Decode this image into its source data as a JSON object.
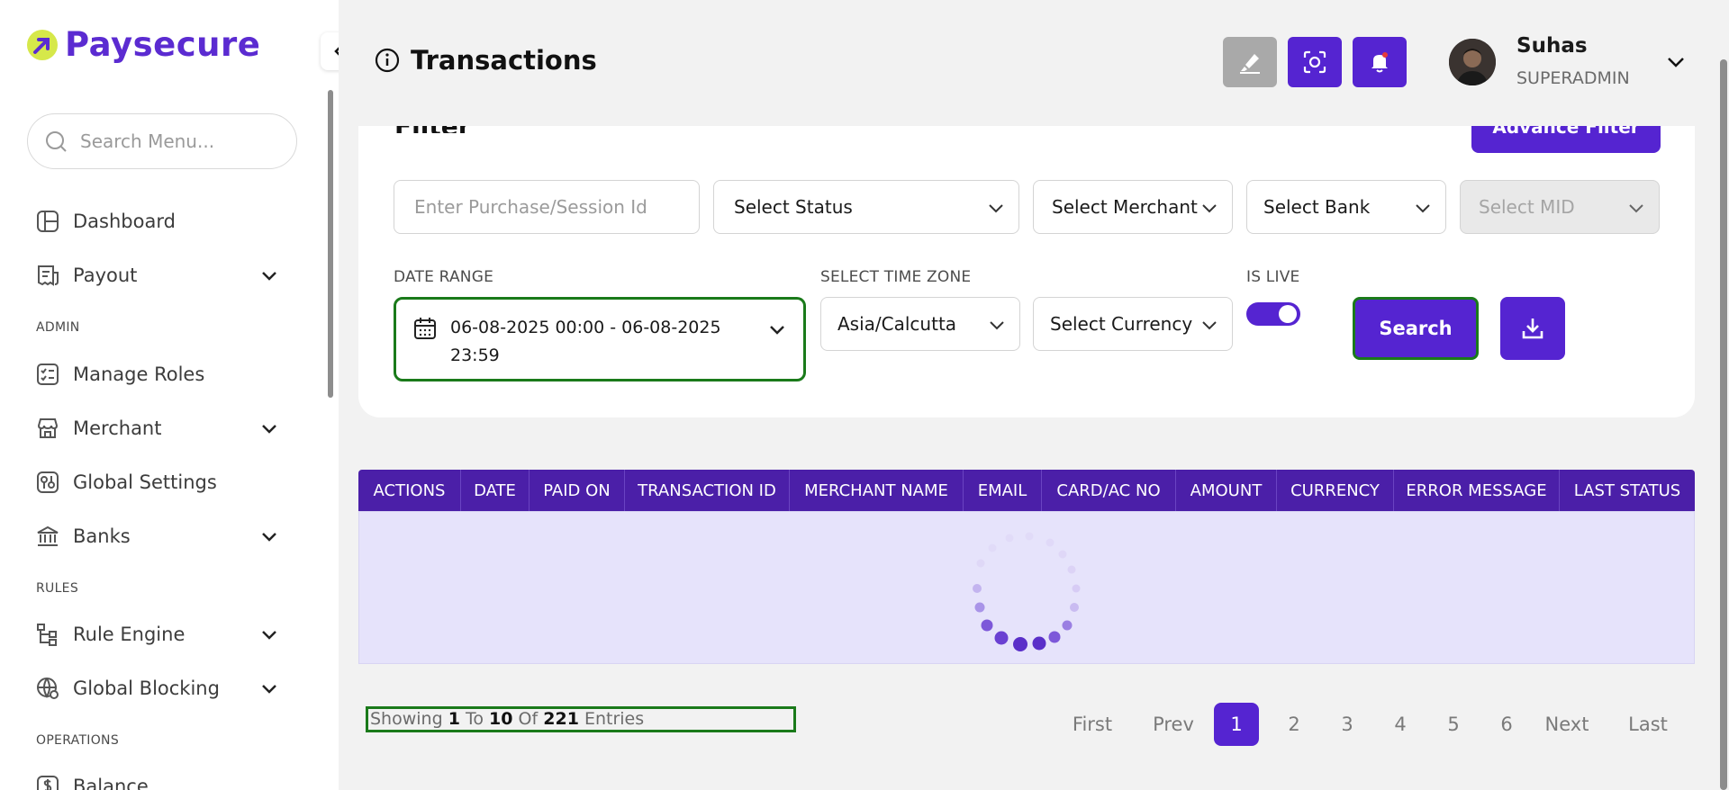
{
  "brand": {
    "name": "Paysecure"
  },
  "sidebar": {
    "search_placeholder": "Search Menu...",
    "items": [
      {
        "label": "Dashboard"
      },
      {
        "label": "Payout"
      },
      {
        "label": "Manage Roles"
      },
      {
        "label": "Merchant"
      },
      {
        "label": "Global Settings"
      },
      {
        "label": "Banks"
      },
      {
        "label": "Rule Engine"
      },
      {
        "label": "Global Blocking"
      },
      {
        "label": "Balance"
      }
    ],
    "sections": {
      "admin": "ADMIN",
      "rules": "RULES",
      "operations": "OPERATIONS"
    }
  },
  "header": {
    "title": "Transactions",
    "user": {
      "name": "Suhas",
      "role": "SUPERADMIN"
    }
  },
  "filter": {
    "title": "Filter",
    "advance_filter_label": "Advance Filter",
    "purchase_placeholder": "Enter Purchase/Session Id",
    "status": "Select Status",
    "merchant": "Select Merchant",
    "bank": "Select Bank",
    "mid": "Select MID",
    "date_range_label": "DATE RANGE",
    "date_range_value": "06-08-2025 00:00 - 06-08-2025 23:59",
    "time_zone_label": "SELECT TIME ZONE",
    "time_zone": "Asia/Calcutta",
    "currency": "Select Currency",
    "is_live_label": "IS LIVE",
    "is_live": true,
    "search_label": "Search"
  },
  "table": {
    "columns": [
      "ACTIONS",
      "DATE",
      "PAID ON",
      "TRANSACTION ID",
      "MERCHANT NAME",
      "EMAIL",
      "CARD/AC NO",
      "AMOUNT",
      "CURRENCY",
      "ERROR MESSAGE",
      "LAST STATUS"
    ]
  },
  "pagination": {
    "showing_prefix": "Showing",
    "from": "1",
    "to_word": "To",
    "to": "10",
    "of_word": "Of",
    "total": "221",
    "entries_word": "Entries",
    "first": "First",
    "prev": "Prev",
    "pages": [
      "1",
      "2",
      "3",
      "4",
      "5",
      "6"
    ],
    "current_page": "1",
    "next": "Next",
    "last": "Last"
  },
  "colors": {
    "accent": "#5524d1",
    "table_header": "#4b1fa8",
    "focus_outline": "#1a7a1a"
  }
}
